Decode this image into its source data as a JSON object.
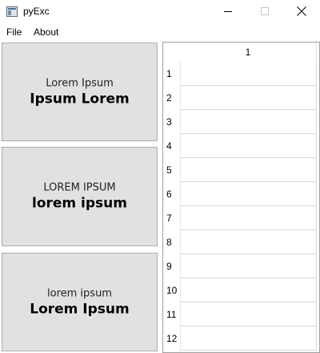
{
  "window": {
    "title": "pyExc",
    "controls": [
      "minimize",
      "maximize",
      "close"
    ]
  },
  "menubar": {
    "items": [
      "File",
      "About"
    ]
  },
  "panels": [
    {
      "subtitle": "Lorem Ipsum",
      "title": "Ipsum Lorem"
    },
    {
      "subtitle": "LOREM IPSUM",
      "title": "lorem ipsum"
    },
    {
      "subtitle": "lorem ipsum",
      "title": "Lorem Ipsum"
    }
  ],
  "table": {
    "columns": [
      "1"
    ],
    "rows": [
      "1",
      "2",
      "3",
      "4",
      "5",
      "6",
      "7",
      "8",
      "9",
      "10",
      "11",
      "12"
    ],
    "cells": [
      "",
      "",
      "",
      "",
      "",
      "",
      "",
      "",
      "",
      "",
      "",
      ""
    ]
  }
}
